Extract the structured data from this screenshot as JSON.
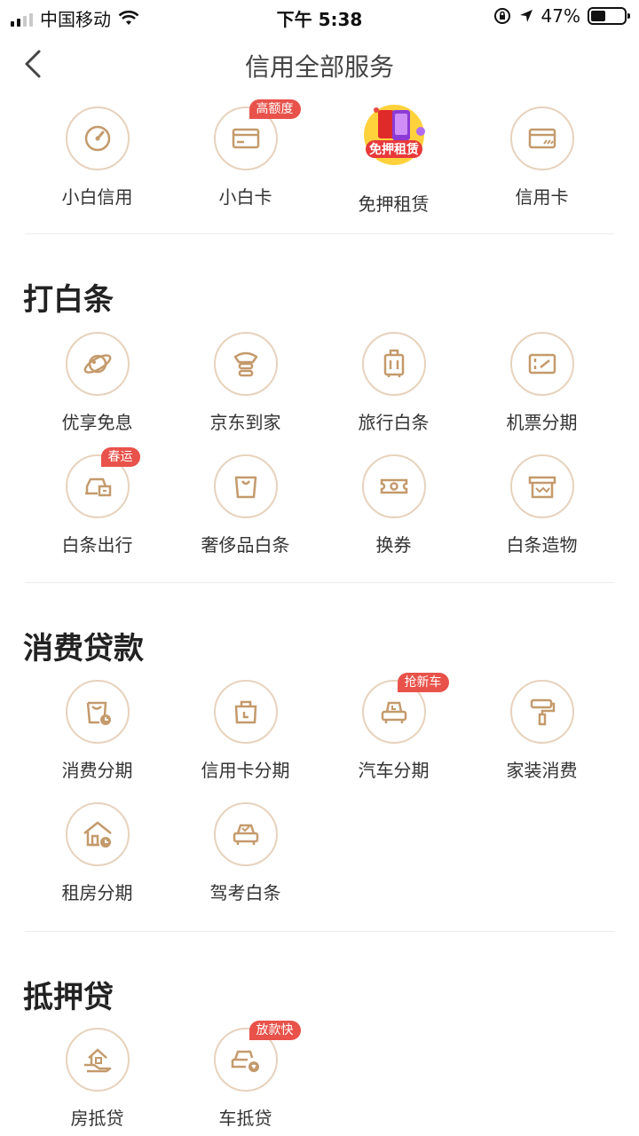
{
  "status_bar": {
    "carrier": "中国移动",
    "time": "下午 5:38",
    "battery": "47%"
  },
  "nav": {
    "title": "信用全部服务"
  },
  "top_row": [
    {
      "label": "小白信用",
      "icon": "gauge-icon"
    },
    {
      "label": "小白卡",
      "icon": "card-icon",
      "badge": "高额度"
    },
    {
      "label": "免押租赁",
      "icon": "phone-promo-icon",
      "promo_text": "免押租赁"
    },
    {
      "label": "信用卡",
      "icon": "credit-card-icon"
    }
  ],
  "sections": [
    {
      "title": "打白条",
      "items": [
        {
          "label": "优享免息",
          "icon": "planet-icon"
        },
        {
          "label": "京东到家",
          "icon": "mascot-icon"
        },
        {
          "label": "旅行白条",
          "icon": "suitcase-icon"
        },
        {
          "label": "机票分期",
          "icon": "ticket-icon"
        },
        {
          "label": "白条出行",
          "icon": "taxi-icon",
          "badge": "春运"
        },
        {
          "label": "奢侈品白条",
          "icon": "shopping-bag-icon"
        },
        {
          "label": "换券",
          "icon": "coupon-icon"
        },
        {
          "label": "白条造物",
          "icon": "store-icon"
        }
      ]
    },
    {
      "title": "消费贷款",
      "items": [
        {
          "label": "消费分期",
          "icon": "bag-clock-icon"
        },
        {
          "label": "信用卡分期",
          "icon": "bag-clock-icon-2"
        },
        {
          "label": "汽车分期",
          "icon": "car-clock-icon",
          "badge": "抢新车"
        },
        {
          "label": "家装消费",
          "icon": "paint-roller-icon"
        },
        {
          "label": "租房分期",
          "icon": "house-clock-icon"
        },
        {
          "label": "驾考白条",
          "icon": "car-check-icon"
        }
      ]
    },
    {
      "title": "抵押贷",
      "items": [
        {
          "label": "房抵贷",
          "icon": "house-hand-icon"
        },
        {
          "label": "车抵贷",
          "icon": "car-heart-icon",
          "badge": "放款快"
        }
      ]
    }
  ],
  "colors": {
    "accent": "#c49a6c",
    "circle_border": "#e7d2bd",
    "badge": "#e8524a"
  }
}
